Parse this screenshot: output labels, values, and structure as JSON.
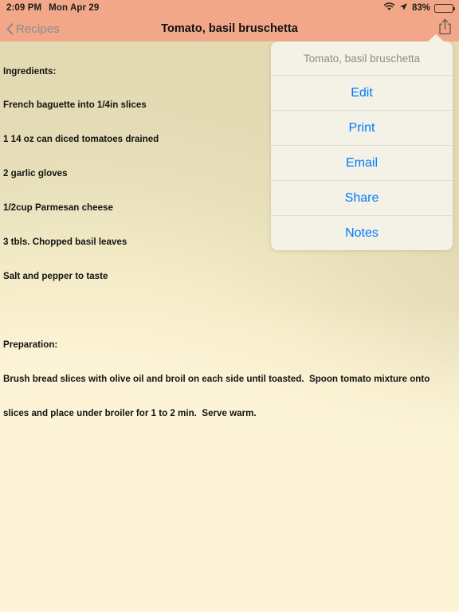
{
  "status_bar": {
    "time": "2:09 PM",
    "date": "Mon Apr 29",
    "wifi_icon": "wifi-icon",
    "location_icon": "location-arrow-icon",
    "battery_percent": "83%",
    "battery_level": 83,
    "battery_icon": "battery-icon",
    "background_color": "#f2a888"
  },
  "nav_bar": {
    "back_icon": "chevron-left-icon",
    "back_label": "Recipes",
    "title": "Tomato, basil bruschetta",
    "share_icon": "share-icon",
    "background_color": "#f2a888"
  },
  "recipe": {
    "ingredients_heading": "Ingredients:",
    "ingredients": [
      "French baguette into 1/4in slices",
      "1 14 oz can diced tomatoes drained",
      "2 garlic gloves",
      "1/2cup Parmesan cheese",
      "3 tbls. Chopped basil leaves",
      "Salt and pepper to taste"
    ],
    "preparation_heading": "Preparation:",
    "preparation": [
      "Brush bread slices with olive oil and broil on each side until toasted.  Spoon tomato mixture onto",
      "slices and place under broiler for 1 to 2 min.  Serve warm."
    ]
  },
  "popover": {
    "header_title": "Tomato, basil bruschetta",
    "accent_color": "#007aff",
    "background_color": "#f4f1e7",
    "items": [
      {
        "label": "Edit",
        "name": "popover-item-edit"
      },
      {
        "label": "Print",
        "name": "popover-item-print"
      },
      {
        "label": "Email",
        "name": "popover-item-email"
      },
      {
        "label": "Share",
        "name": "popover-item-share"
      },
      {
        "label": "Notes",
        "name": "popover-item-notes"
      }
    ]
  }
}
